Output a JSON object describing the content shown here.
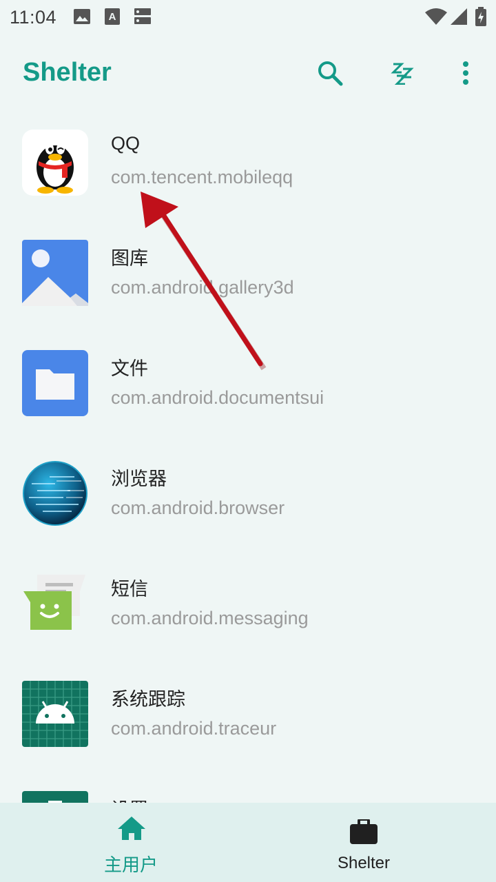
{
  "status_bar": {
    "time": "11:04",
    "icons": [
      "image-icon",
      "a-icon",
      "server-icon",
      "wifi-icon",
      "signal-icon",
      "battery-charging-icon"
    ]
  },
  "app_bar": {
    "title": "Shelter",
    "actions": [
      "search-icon",
      "freeze-zzz-icon",
      "more-vert-icon"
    ],
    "accent_color": "#149a88"
  },
  "apps": [
    {
      "name": "QQ",
      "package": "com.tencent.mobileqq",
      "icon": "qq-penguin-icon"
    },
    {
      "name": "图库",
      "package": "com.android.gallery3d",
      "icon": "gallery-icon"
    },
    {
      "name": "文件",
      "package": "com.android.documentsui",
      "icon": "folder-icon"
    },
    {
      "name": "浏览器",
      "package": "com.android.browser",
      "icon": "globe-icon"
    },
    {
      "name": "短信",
      "package": "com.android.messaging",
      "icon": "messaging-icon"
    },
    {
      "name": "系统跟踪",
      "package": "com.android.traceur",
      "icon": "android-traceur-icon"
    },
    {
      "name": "设置",
      "package": "",
      "icon": "settings-icon"
    }
  ],
  "bottom_nav": {
    "items": [
      {
        "label": "主用户",
        "icon": "home-icon",
        "selected": true
      },
      {
        "label": "Shelter",
        "icon": "briefcase-icon",
        "selected": false
      }
    ]
  },
  "annotation": {
    "type": "red-arrow",
    "points_to": "com.tencent.mobileqq",
    "color": "#c0101a"
  }
}
